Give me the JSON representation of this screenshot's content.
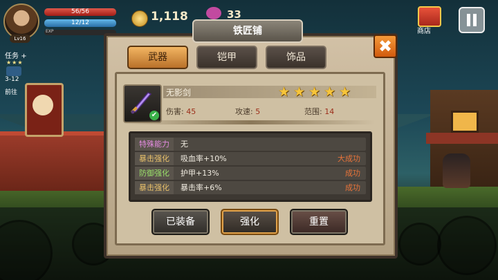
{
  "hud": {
    "hp_text": "56/56",
    "mp_text": "12/12",
    "exp_label": "EXP",
    "level": "Lv16",
    "gold": "1,118",
    "gems": "33",
    "quest_label": "任务",
    "quest_plus": "+",
    "quest_stars": "★★★",
    "quest_stage": "3-12",
    "quest_go": "前往",
    "shop_label": "商店"
  },
  "dialog": {
    "title": "铁匠铺",
    "close_label": "✖",
    "tabs": [
      {
        "label": "武器",
        "active": true
      },
      {
        "label": "铠甲",
        "active": false
      },
      {
        "label": "饰品",
        "active": false
      }
    ],
    "item": {
      "name": "无影剑",
      "stars": 5,
      "stats": [
        {
          "label": "伤害:",
          "value": "45"
        },
        {
          "label": "攻速:",
          "value": "5"
        },
        {
          "label": "范围:",
          "value": "14"
        }
      ]
    },
    "enhancements": [
      {
        "label": "特殊能力",
        "label_color": "#e48be0",
        "value": "无",
        "result": ""
      },
      {
        "label": "暴击强化",
        "label_color": "#e8c06a",
        "value": "吸血率+10%",
        "result": "大成功"
      },
      {
        "label": "防御强化",
        "label_color": "#9be06a",
        "value": "护甲+13%",
        "result": "成功"
      },
      {
        "label": "暴击强化",
        "label_color": "#e8c06a",
        "value": "暴击率+6%",
        "result": "成功"
      }
    ],
    "buttons": {
      "equipped": "已装备",
      "enhance": "强化",
      "reset": "重置"
    }
  }
}
